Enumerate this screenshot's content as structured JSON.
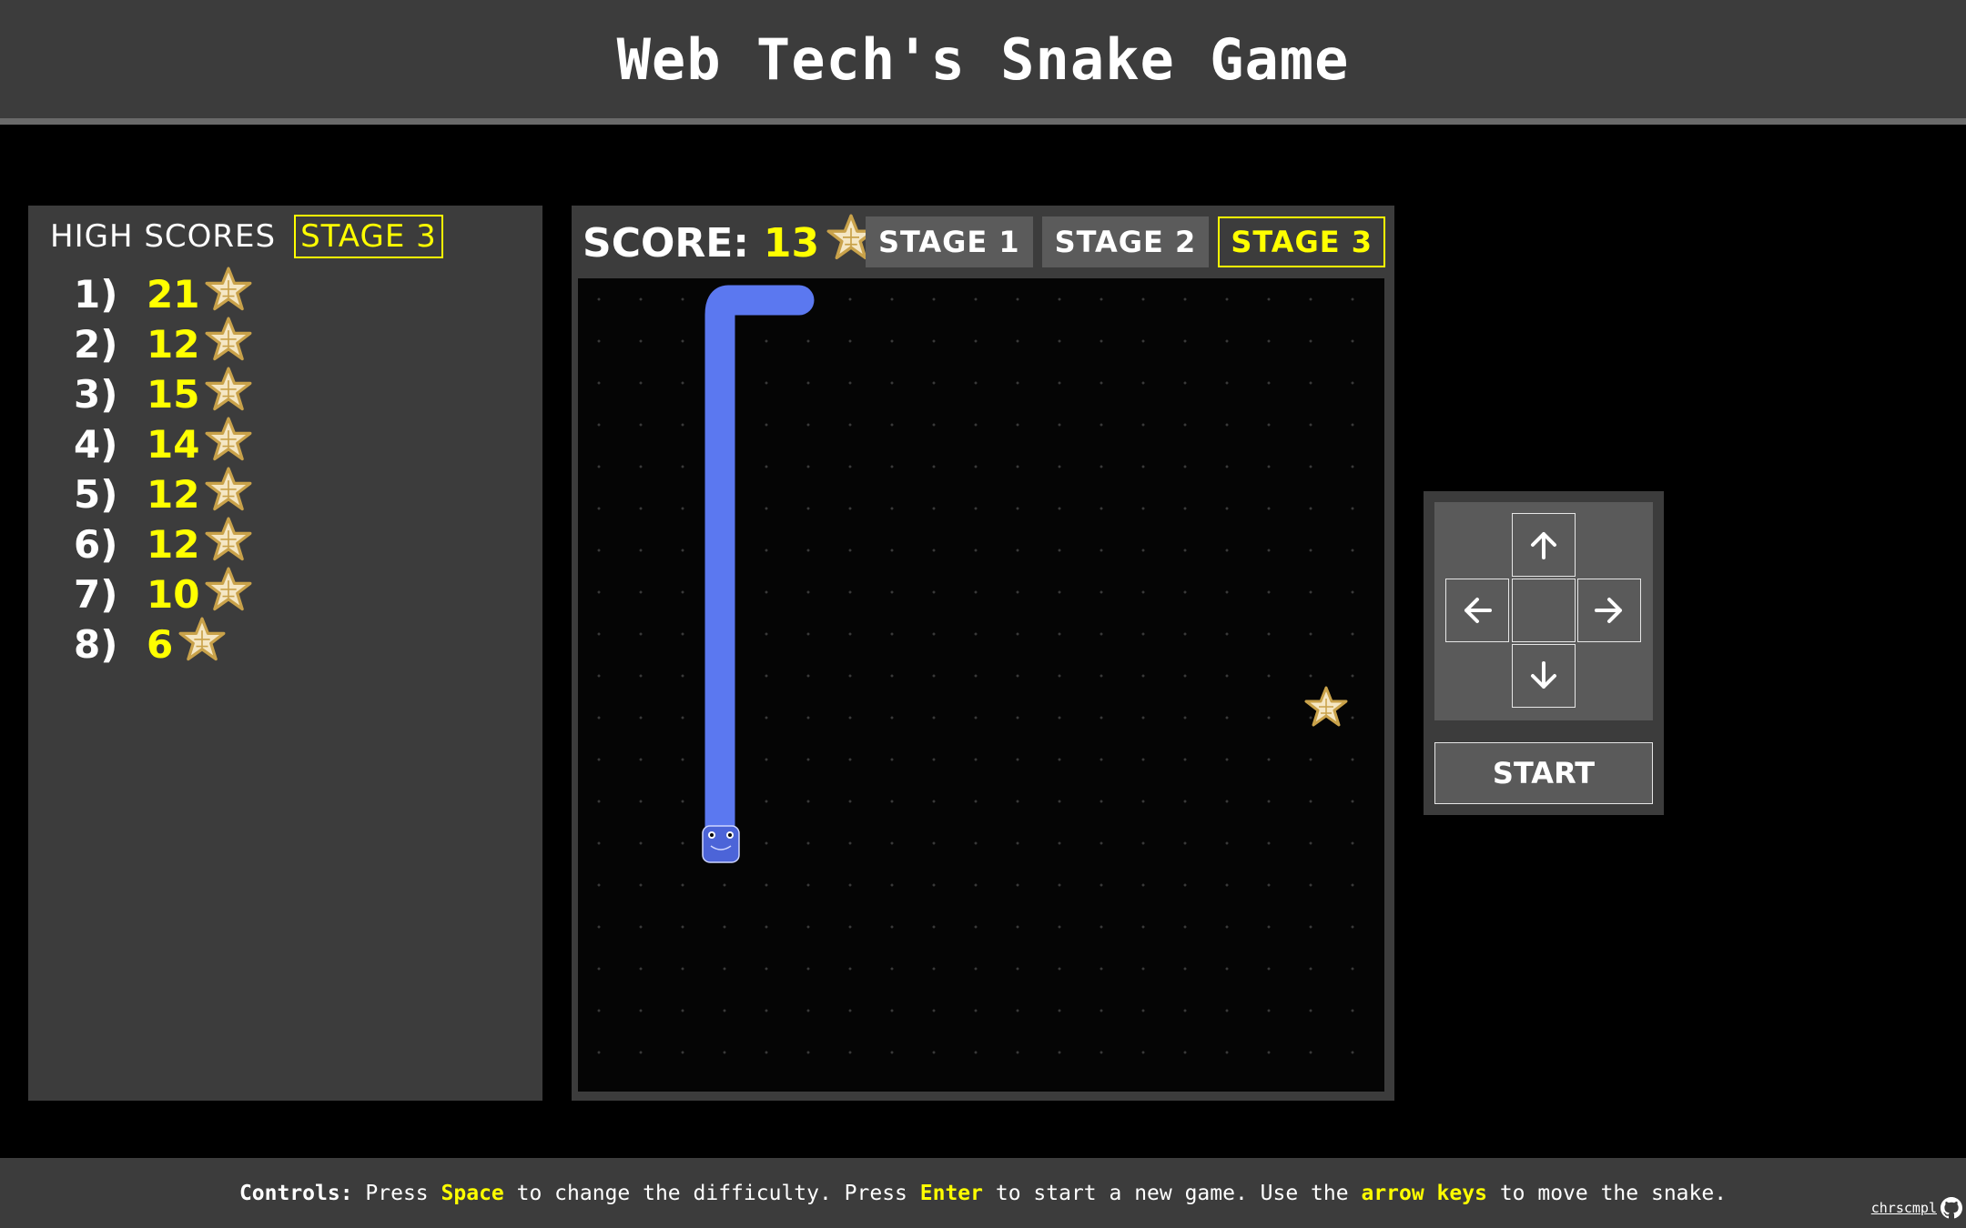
{
  "header": {
    "title": "Web Tech's Snake Game"
  },
  "high_scores": {
    "title": "HIGH SCORES",
    "stage": "STAGE 3",
    "entries": [
      {
        "rank": "1)",
        "score": "21"
      },
      {
        "rank": "2)",
        "score": "12"
      },
      {
        "rank": "3)",
        "score": "15"
      },
      {
        "rank": "4)",
        "score": "14"
      },
      {
        "rank": "5)",
        "score": "12"
      },
      {
        "rank": "6)",
        "score": "12"
      },
      {
        "rank": "7)",
        "score": "10"
      },
      {
        "rank": "8)",
        "score": "6"
      }
    ]
  },
  "game": {
    "score_label": "SCORE:",
    "score": "13",
    "stages": [
      {
        "label": "STAGE 1",
        "active": false
      },
      {
        "label": "STAGE 2",
        "active": false
      },
      {
        "label": "STAGE 3",
        "active": true
      }
    ],
    "snake_color": "#5b78f0",
    "food_icon": "star-icon"
  },
  "controls": {
    "up_icon": "arrow-up-icon",
    "down_icon": "arrow-down-icon",
    "left_icon": "arrow-left-icon",
    "right_icon": "arrow-right-icon",
    "start_label": "START"
  },
  "footer": {
    "controls_label": "Controls:",
    "t1": "Press",
    "space": "Space",
    "t2": "to change the difficulty. Press",
    "enter": "Enter",
    "t3": "to start a new game. Use the",
    "arrow_keys": "arrow keys",
    "t4": "to move the snake.",
    "credit": "chrscmpl"
  },
  "colors": {
    "accent": "#ffff00",
    "panel": "#3c3c3c",
    "background": "#000000"
  }
}
